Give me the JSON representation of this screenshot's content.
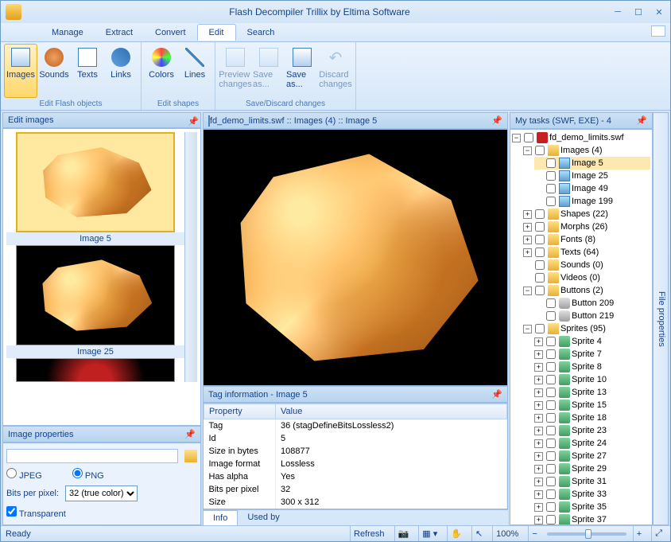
{
  "app": {
    "title": "Flash Decompiler Trillix by Eltima Software"
  },
  "menu": {
    "items": [
      "Manage",
      "Extract",
      "Convert",
      "Edit",
      "Search"
    ],
    "active_index": 3
  },
  "ribbon": {
    "groups": [
      {
        "label": "Edit Flash objects",
        "buttons": [
          {
            "label": "Images",
            "selected": true
          },
          {
            "label": "Sounds"
          },
          {
            "label": "Texts"
          },
          {
            "label": "Links"
          }
        ]
      },
      {
        "label": "Edit shapes",
        "buttons": [
          {
            "label": "Colors"
          },
          {
            "label": "Lines"
          }
        ]
      },
      {
        "label": "Save/Discard changes",
        "buttons": [
          {
            "label": "Preview changes",
            "disabled": true
          },
          {
            "label": "Save as...",
            "disabled": true
          },
          {
            "label": "Save as..."
          },
          {
            "label": "Discard changes",
            "disabled": true
          }
        ]
      }
    ]
  },
  "left": {
    "header": "Edit images",
    "thumbs": [
      {
        "label": "Image 5",
        "selected": true
      },
      {
        "label": "Image 25"
      }
    ],
    "props_header": "Image properties",
    "path_value": "",
    "format_jpeg": "JPEG",
    "format_png": "PNG",
    "format_selected": "png",
    "bpp_label": "Bits per pixel:",
    "bpp_value": "32 (true color)",
    "transparent_label": "Transparent",
    "transparent_checked": true
  },
  "center": {
    "breadcrumb": "fd_demo_limits.swf :: Images (4) :: Image 5",
    "tag_header": "Tag information - Image 5",
    "columns": {
      "property": "Property",
      "value": "Value"
    },
    "rows": [
      {
        "p": "Tag",
        "v": "36 (stagDefineBitsLossless2)"
      },
      {
        "p": "Id",
        "v": "5"
      },
      {
        "p": "Size in bytes",
        "v": "108877"
      },
      {
        "p": "Image format",
        "v": "Lossless"
      },
      {
        "p": "Has alpha",
        "v": "Yes"
      },
      {
        "p": "Bits per pixel",
        "v": "32"
      },
      {
        "p": "Size",
        "v": "300 x 312"
      }
    ],
    "tabs": {
      "info": "Info",
      "used_by": "Used by",
      "active": "info"
    }
  },
  "right": {
    "header": "My tasks (SWF, EXE) - 4",
    "side_tab": "File properties",
    "tree": {
      "root": "fd_demo_limits.swf",
      "images": {
        "label": "Images (4)",
        "items": [
          "Image 5",
          "Image 25",
          "Image 49",
          "Image 199"
        ],
        "selected": "Image 5"
      },
      "shapes": "Shapes (22)",
      "morphs": "Morphs (26)",
      "fonts": "Fonts (8)",
      "texts": "Texts (64)",
      "sounds": "Sounds (0)",
      "videos": "Videos (0)",
      "buttons": {
        "label": "Buttons (2)",
        "items": [
          "Button 209",
          "Button 219"
        ]
      },
      "sprites": {
        "label": "Sprites (95)",
        "items": [
          "Sprite 4",
          "Sprite 7",
          "Sprite 8",
          "Sprite 10",
          "Sprite 13",
          "Sprite 15",
          "Sprite 18",
          "Sprite 23",
          "Sprite 24",
          "Sprite 27",
          "Sprite 29",
          "Sprite 31",
          "Sprite 33",
          "Sprite 35",
          "Sprite 37"
        ]
      }
    }
  },
  "status": {
    "ready": "Ready",
    "refresh": "Refresh",
    "zoom": "100%"
  }
}
